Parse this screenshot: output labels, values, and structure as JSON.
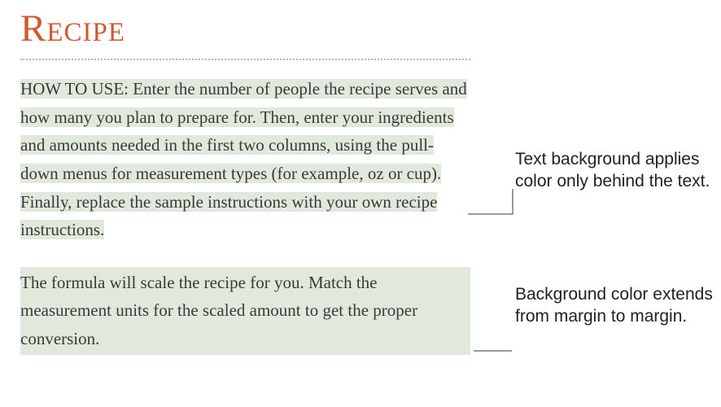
{
  "doc": {
    "title": "Recipe",
    "para1_prefix": "HOW TO USE: ",
    "para1_body": "Enter the number of people the recipe serves and how many you plan to prepare for. Then, enter your ingredients and amounts needed in the first two columns, using the pull-down menus for measurement types (for example, oz or cup). Finally, replace the sample instructions with your own recipe instructions.",
    "para2": "The formula will scale the recipe for you. Match the measurement units for the scaled amount to get the proper conversion."
  },
  "callouts": {
    "c1": "Text background applies color only behind the text.",
    "c2": "Background color extends from margin to margin."
  },
  "colors": {
    "title": "#d05a2c",
    "highlight": "#e1e9dc"
  }
}
